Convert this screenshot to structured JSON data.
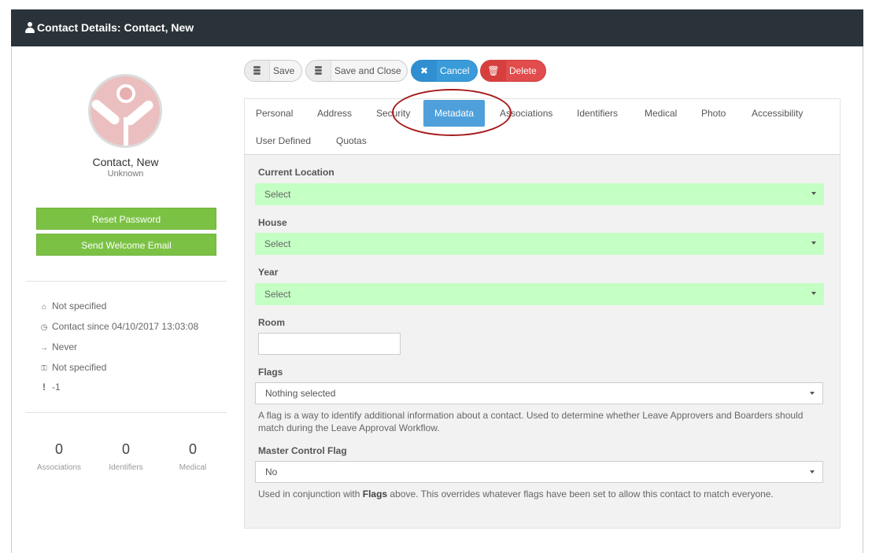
{
  "window": {
    "title": "Contact Details: Contact, New"
  },
  "profile": {
    "name": "Contact, New",
    "subtitle": "Unknown",
    "reset_password": "Reset Password",
    "send_welcome": "Send Welcome Email",
    "info": {
      "address": "Not specified",
      "contact_since": "Contact since 04/10/2017 13:03:08",
      "last_login": "Never",
      "key": "Not specified",
      "priority": "-1"
    },
    "stats": [
      {
        "value": "0",
        "label": "Associations"
      },
      {
        "value": "0",
        "label": "Identifiers"
      },
      {
        "value": "0",
        "label": "Medical"
      }
    ]
  },
  "toolbar": {
    "save": "Save",
    "save_close": "Save and Close",
    "cancel": "Cancel",
    "delete": "Delete"
  },
  "tabs": [
    "Personal",
    "Address",
    "Security",
    "Metadata",
    "Associations",
    "Identifiers",
    "Medical",
    "Photo",
    "Accessibility",
    "User Defined",
    "Quotas"
  ],
  "active_tab": "Metadata",
  "form": {
    "current_location": {
      "label": "Current Location",
      "value": "Select"
    },
    "house": {
      "label": "House",
      "value": "Select"
    },
    "year": {
      "label": "Year",
      "value": "Select"
    },
    "room": {
      "label": "Room",
      "value": ""
    },
    "flags": {
      "label": "Flags",
      "value": "Nothing selected",
      "help": "A flag is a way to identify additional information about a contact. Used to determine whether Leave Approvers and Boarders should match during the Leave Approval Workflow."
    },
    "master_control": {
      "label": "Master Control Flag",
      "value": "No",
      "help_pre": "Used in conjunction with ",
      "help_bold": "Flags",
      "help_post": " above. This overrides whatever flags have been set to allow this contact to match everyone."
    }
  },
  "colors": {
    "titlebar": "#2a3339",
    "green_button": "#7bc244",
    "active_tab": "#4fa0da",
    "cancel": "#3a9bd9",
    "delete": "#e14c4c",
    "select_highlight": "#c4ffc4",
    "annotation": "#a61c1c"
  }
}
